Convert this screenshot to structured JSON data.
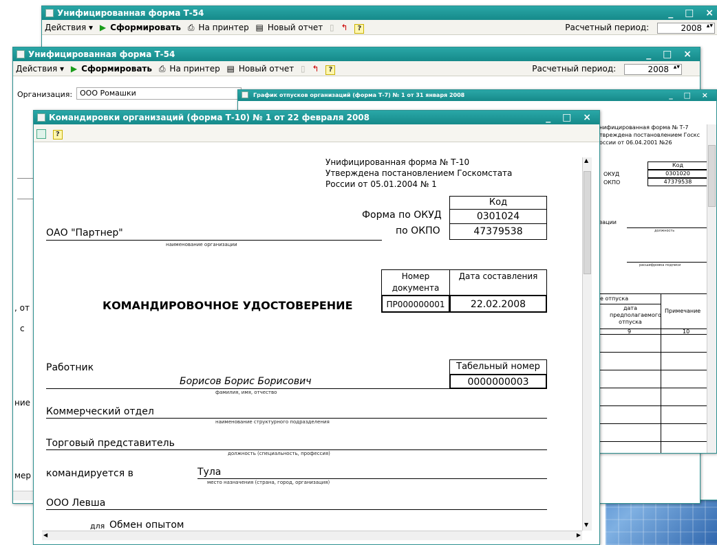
{
  "back_window": {
    "title": "Унифицированная форма Т-54",
    "toolbar": {
      "actions": "Действия ▾",
      "form": "Сформировать",
      "print": "На принтер",
      "new_report": "Новый отчет",
      "period_label": "Расчетный период:",
      "period_value": "2008"
    }
  },
  "mid_window": {
    "title": "Унифицированная форма Т-54",
    "toolbar": {
      "actions": "Действия ▾",
      "form": "Сформировать",
      "print": "На принтер",
      "new_report": "Новый отчет",
      "period_label": "Расчетный период:",
      "period_value": "2008"
    },
    "org_label": "Организация:",
    "org_value": "ООО Ромашки",
    "left_fragments": [
      ", от",
      "с",
      "ние",
      "мер"
    ]
  },
  "t7_window": {
    "title": "График отпусков организаций (форма Т-7) № 1 от 31 января 2008",
    "header": [
      "нифицированная форма № Т-7",
      "твреждена постановлением Госкс",
      "оссии от 06.04.2001 №26"
    ],
    "code_label": "Код",
    "okud_label": "ОКУД",
    "okud_value": "0301020",
    "okpo_label": "ОКПО",
    "okpo_value": "47379538",
    "org_fragment": "зации",
    "position_caption": "должность",
    "signature_caption": "расшифровка подписи",
    "table": {
      "col_vacation": "е отпуска",
      "col_date": "дата предполагаемого отпуска",
      "col_note": "Примечание",
      "num_9": "9",
      "num_10": "10"
    }
  },
  "t10_window": {
    "title": "Командировки организаций (форма Т-10) № 1 от 22 февраля 2008",
    "help": "?",
    "doc": {
      "form_header": [
        "Унифицированная форма № Т-10",
        "Утверждена постановлением Госкомстата",
        "России от 05.01.2004 № 1"
      ],
      "code_label": "Код",
      "okud_label": "Форма по ОКУД",
      "okud_value": "0301024",
      "okpo_label": "по ОКПО",
      "okpo_value": "47379538",
      "org_name": "ОАО \"Партнер\"",
      "org_caption": "наименование организации",
      "doc_number_label": "Номер документа",
      "doc_date_label": "Дата составления",
      "doc_number": "ПР000000001",
      "doc_date": "22.02.2008",
      "doc_title": "КОМАНДИРОВОЧНОЕ УДОСТОВЕРЕНИЕ",
      "employee_label": "Работник",
      "tab_number_label": "Табельный номер",
      "tab_number": "0000000003",
      "employee_name": "Борисов Борис Борисович",
      "name_caption": "фамилия, имя, отчество",
      "department": "Коммерческий отдел",
      "department_caption": "наименование структурного подразделения",
      "position": "Торговый представитель",
      "position_caption": "должность (специальность, профессия)",
      "sent_to_label": "командируется в",
      "destination": "Тула",
      "destination_caption": "место назначения (страна, город, организация)",
      "organization": "ООО Левша",
      "purpose_label": "для",
      "purpose": "Обмен опытом"
    }
  }
}
